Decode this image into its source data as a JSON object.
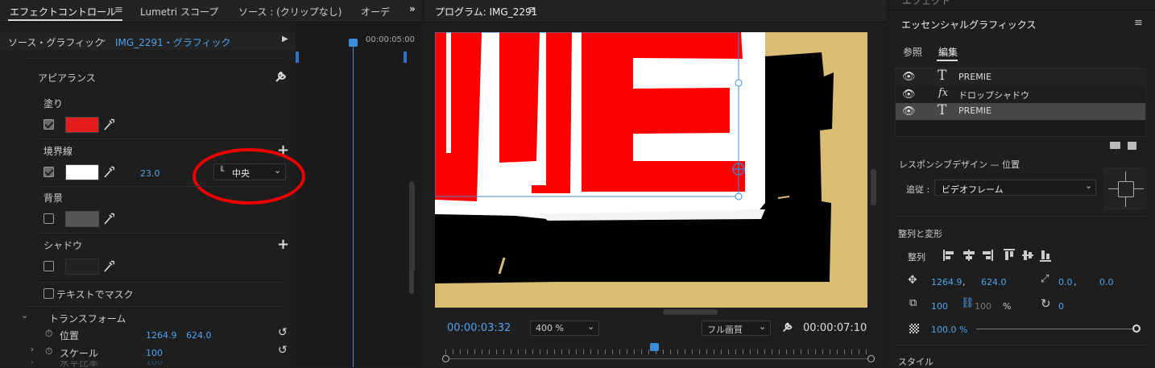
{
  "effect_panel": {
    "tabs": [
      "エフェクトコントロール",
      "Lumetri スコープ",
      "ソース : (クリップなし)",
      "オーデ"
    ],
    "source_label": "ソース・グラフィック",
    "clip_label": "IMG_2291・グラフィック",
    "timecode": "00:00:05:00",
    "appearance_header": "アピアランス",
    "fill_label": "塗り",
    "fill_color": "#e31c1c",
    "stroke_label": "境界線",
    "stroke_color": "#ffffff",
    "stroke_width": "23.0",
    "stroke_position": "中央",
    "background_label": "背景",
    "shadow_label": "シャドウ",
    "mask_label": "テキストでマスク",
    "transform_header": "トランスフォーム",
    "position_label": "位置",
    "position_x": "1264.9",
    "position_y": "624.0",
    "scale_label": "スケール",
    "scale_value": "100",
    "partial_row_label": "水平比率",
    "partial_row_value": "100"
  },
  "program": {
    "title": "プログラム: IMG_2291",
    "timecode_current": "00:00:03:32",
    "zoom": "400 %",
    "quality": "フル画質",
    "timecode_end": "00:00:07:10",
    "playhead_fraction": 0.49
  },
  "essential": {
    "top_label": "エフェクト",
    "title": "エッセンシャルグラフィックス",
    "tab_browse": "参照",
    "tab_edit": "編集",
    "layers": [
      {
        "type": "T",
        "name": "PREMIE"
      },
      {
        "type": "fx",
        "name": "ドロップシャドウ"
      },
      {
        "type": "T",
        "name": "PREMIE"
      }
    ],
    "responsive_label": "レスポンシブデザイン — 位置",
    "follow_label": "追従 :",
    "follow_value": "ビデオフレーム",
    "align_header": "整列と変形",
    "align_label": "整列",
    "pos_x": "1264.9",
    "pos_y": "624.0",
    "anchor_x": "0.0",
    "anchor_y": "0.0",
    "scale": "100",
    "scale_linked": "100",
    "percent": "%",
    "rotation": "0",
    "opacity": "100.0 %",
    "style_header": "スタイル"
  }
}
